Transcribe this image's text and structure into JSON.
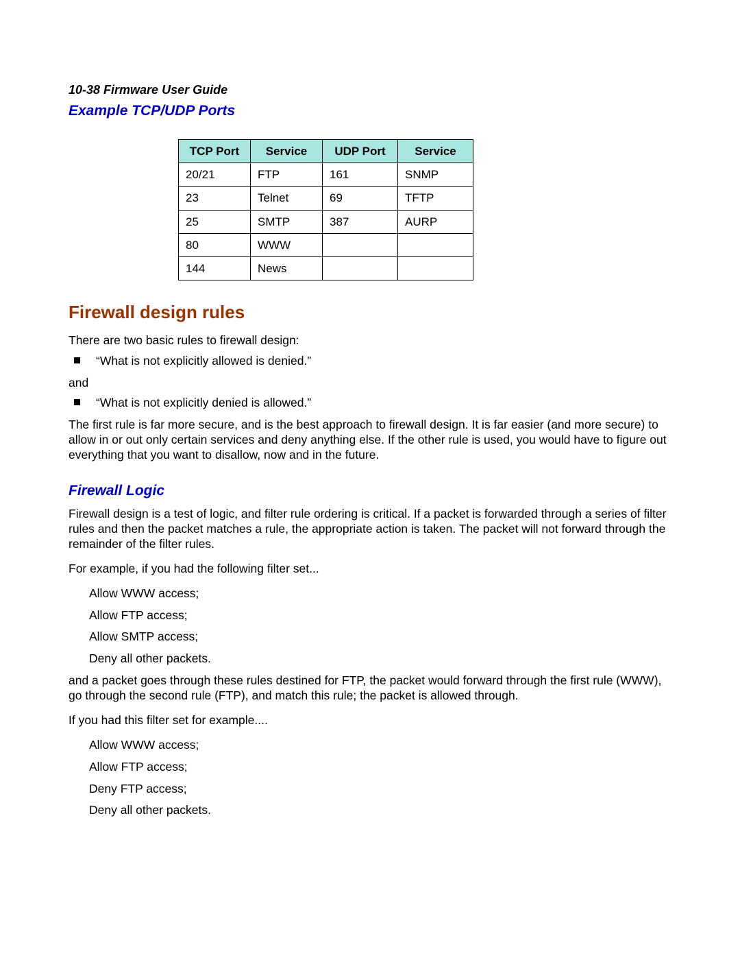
{
  "header": {
    "running_head": "10-38  Firmware User Guide"
  },
  "sections": {
    "example_ports_title": "Example TCP/UDP Ports",
    "firewall_rules_title": "Firewall design rules",
    "firewall_logic_title": "Firewall Logic"
  },
  "ports_table": {
    "headers": {
      "tcp_port": "TCP Port",
      "service1": "Service",
      "udp_port": "UDP Port",
      "service2": "Service"
    },
    "rows": [
      {
        "tcp": "20/21",
        "svc1": "FTP",
        "udp": "161",
        "svc2": "SNMP"
      },
      {
        "tcp": "23",
        "svc1": "Telnet",
        "udp": "69",
        "svc2": "TFTP"
      },
      {
        "tcp": "25",
        "svc1": "SMTP",
        "udp": "387",
        "svc2": "AURP"
      },
      {
        "tcp": "80",
        "svc1": "WWW",
        "udp": "",
        "svc2": ""
      },
      {
        "tcp": "144",
        "svc1": "News",
        "udp": "",
        "svc2": ""
      }
    ]
  },
  "text": {
    "intro_rules": "There are two basic rules to firewall design:",
    "rule1": "“What is not explicitly allowed is denied.”",
    "and": "and",
    "rule2": "“What is not explicitly denied is allowed.”",
    "rules_para": "The first rule is far more secure, and is the best approach to firewall design. It is far easier (and more secure) to allow in or out only certain services and deny anything else. If the other rule is used, you would have to figure out everything that you want to disallow, now and in the future.",
    "logic_para1": "Firewall design is a test of logic, and filter rule ordering is critical. If a packet is forwarded through a series of filter rules and then the packet matches a rule, the appropriate action is taken. The packet will not forward through the remainder of the filter rules.",
    "logic_para2": "For example, if you had the following filter set...",
    "filters1": {
      "a": "Allow WWW access;",
      "b": "Allow FTP access;",
      "c": "Allow SMTP access;",
      "d": "Deny all other packets."
    },
    "logic_para3": "and a packet goes through these rules destined for FTP, the packet would forward through the first rule (WWW), go through the second rule (FTP), and match this rule; the packet is allowed through.",
    "logic_para4": "If you had this filter set for example....",
    "filters2": {
      "a": "Allow WWW access;",
      "b": "Allow FTP access;",
      "c": "Deny FTP access;",
      "d": "Deny all other packets."
    }
  }
}
